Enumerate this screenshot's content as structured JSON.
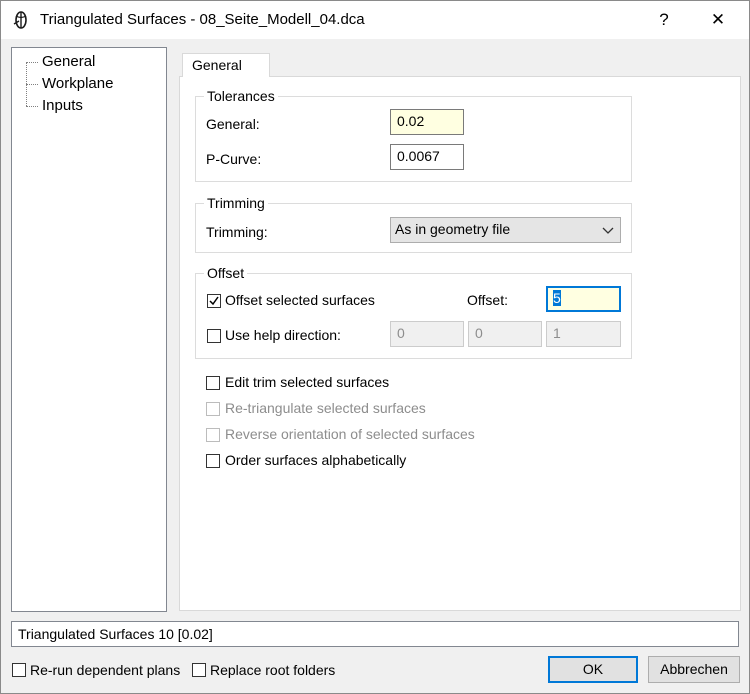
{
  "window": {
    "title": "Triangulated Surfaces - 08_Seite_Modell_04.dca",
    "help_label": "?",
    "close_label": "✕"
  },
  "tree": {
    "items": [
      {
        "label": "General",
        "selected": true
      },
      {
        "label": "Workplane",
        "selected": false
      },
      {
        "label": "Inputs",
        "selected": false
      }
    ]
  },
  "tab": {
    "label": "General"
  },
  "tolerances": {
    "title": "Tolerances",
    "general_label": "General:",
    "general_value": "0.02",
    "pcurve_label": "P-Curve:",
    "pcurve_value": "0.0067"
  },
  "trimming": {
    "title": "Trimming",
    "label": "Trimming:",
    "selected_option": "As in geometry file"
  },
  "offset": {
    "title": "Offset",
    "offset_selected_label": "Offset selected surfaces",
    "offset_selected_checked": true,
    "offset_label": "Offset:",
    "offset_value": "5",
    "help_direction_label": "Use help direction:",
    "help_direction_checked": false,
    "dir_x": "0",
    "dir_y": "0",
    "dir_z": "1"
  },
  "options": {
    "edit_trim_label": "Edit trim selected surfaces",
    "retriangulate_label": "Re-triangulate selected surfaces",
    "reverse_label": "Reverse orientation of selected surfaces",
    "order_label": "Order surfaces alphabetically"
  },
  "status": {
    "text": "Triangulated Surfaces 10 [0.02]"
  },
  "footer": {
    "rerun_label": "Re-run dependent plans",
    "replace_label": "Replace root folders",
    "ok_label": "OK",
    "cancel_label": "Abbrechen"
  },
  "colors": {
    "accent": "#0078d7",
    "field_highlight": "#ffffe1",
    "window_bg": "#f0f0f0"
  }
}
